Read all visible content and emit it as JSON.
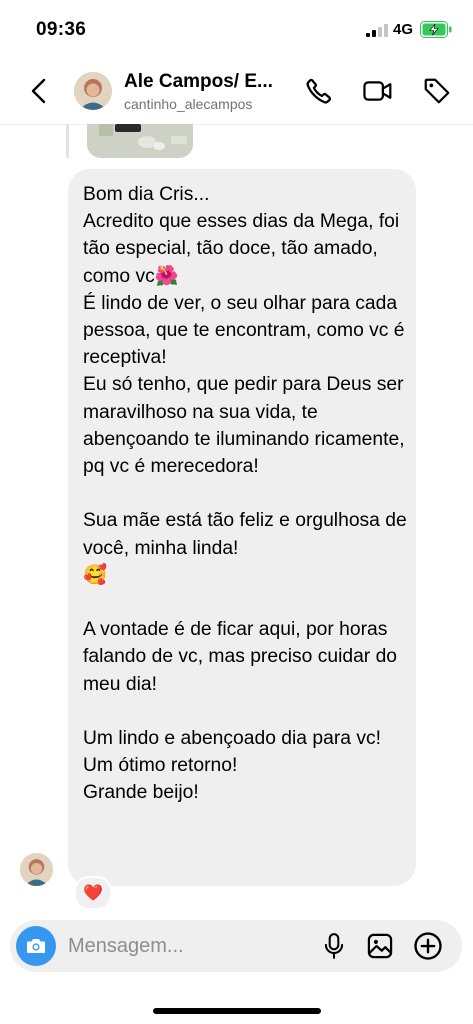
{
  "status_bar": {
    "time": "09:36",
    "network": "4G",
    "signal_icon": "signal-bars-icon",
    "battery_icon": "battery-charging-icon"
  },
  "header": {
    "title": "Ale Campos/ E...",
    "subtitle": "cantinho_alecampos",
    "icons": [
      "back-chevron-icon",
      "phone-icon",
      "video-camera-icon",
      "tag-icon"
    ]
  },
  "message": {
    "text": "Bom dia Cris...\nAcredito que esses dias da Mega, foi tão especial, tão doce, tão amado, como vc🌺\nÉ lindo de ver, o seu olhar para cada pessoa, que te encontram, como vc é receptiva!\nEu só tenho, que pedir para Deus ser maravilhoso na sua vida, te abençoando te iluminando ricamente, pq vc é merecedora!\n\nSua mãe está tão feliz e orgulhosa de você, minha linda!\n🥰\n\nA vontade é de ficar aqui, por horas falando de vc, mas preciso cuidar do meu dia!\n\nUm lindo e abençoado dia para vc!\nUm ótimo retorno!\nGrande beijo!",
    "reaction": "❤️"
  },
  "composer": {
    "placeholder": "Mensagem...",
    "icons": [
      "camera-icon",
      "microphone-icon",
      "image-icon",
      "plus-circle-icon"
    ]
  },
  "colors": {
    "accent": "#3797f0",
    "bubble": "#efefef",
    "reaction_heart": "#ef1a2d"
  }
}
